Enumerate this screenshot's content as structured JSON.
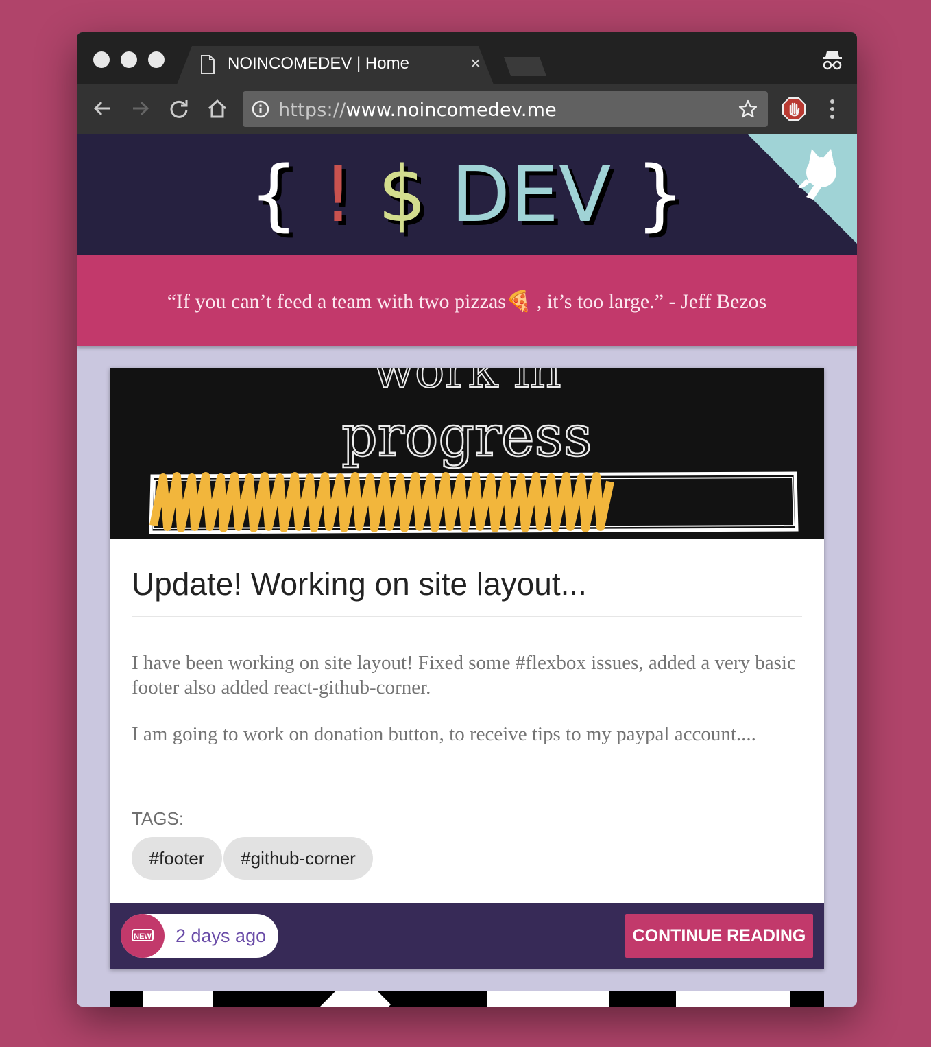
{
  "browser": {
    "tab_title": "NOINCOMEDEV | Home",
    "tab_close": "×",
    "url_scheme": "https://",
    "url_host": "www.noincomedev.me"
  },
  "site": {
    "logo": {
      "open_brace": "{",
      "exclaim": "!",
      "dollar": "$",
      "dev": "DEV",
      "close_brace": "}"
    },
    "quote": "“If you can’t feed a team with two pizzas🍕 , it’s too large.” - Jeff Bezos"
  },
  "colors": {
    "background": "#b0446a",
    "header": "#262140",
    "accent": "#c2396b",
    "footer": "#372a57",
    "logo_exclaim": "#c9524f",
    "logo_dollar": "#d3dd8e",
    "logo_dev": "#a0d3d6",
    "corner": "#a0d3d6"
  },
  "post": {
    "title": "Update! Working on site layout...",
    "paragraphs": [
      "I have been working on site layout! Fixed some #flexbox issues, added a very basic footer also added react-github-corner.",
      "I am going to work on donation button, to receive tips to my paypal account...."
    ],
    "tags_label": "TAGS:",
    "tags": [
      "#footer",
      "#github-corner"
    ],
    "badge": "NEW",
    "time_ago": "2 days ago",
    "cta": "CONTINUE READING",
    "image_text": {
      "line1": "work in",
      "line2": "progress"
    }
  }
}
